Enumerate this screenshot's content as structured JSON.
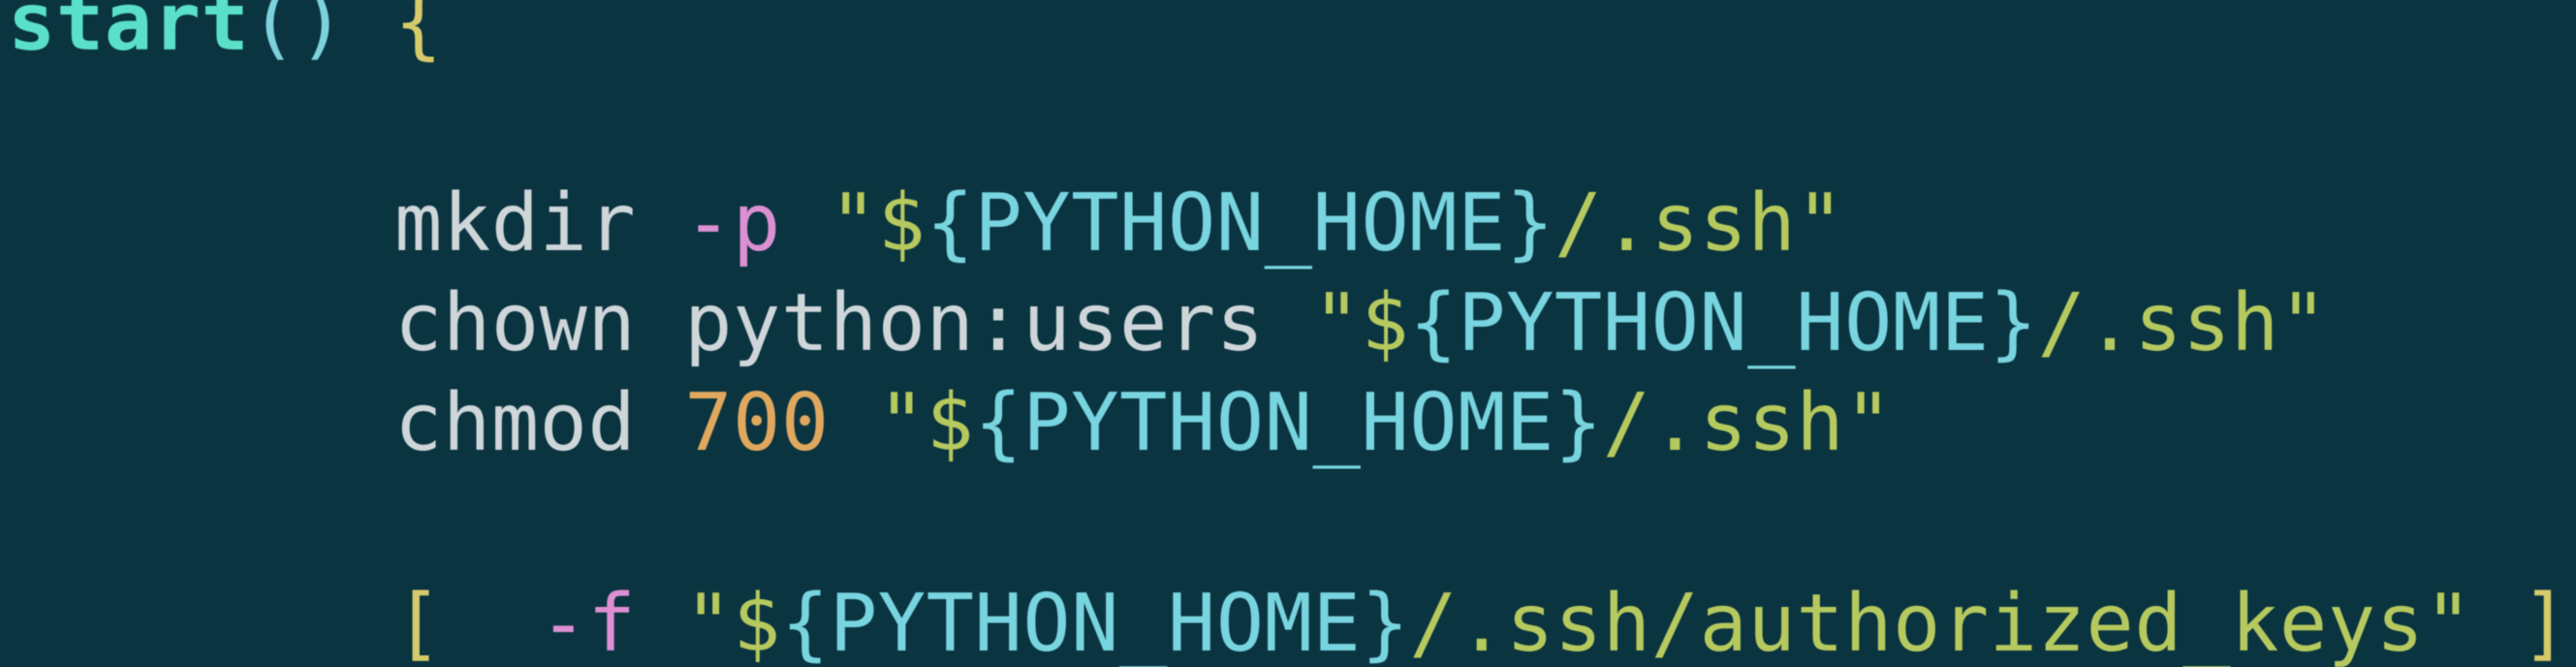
{
  "code": {
    "line1": {
      "func": "start",
      "paren_open": "(",
      "paren_close": ")",
      "brace_open": "{"
    },
    "line2_blank": "",
    "line3": {
      "indent": "        ",
      "cmd": "mkdir",
      "flag": "-p",
      "q1": "\"",
      "dollar": "$",
      "vbo": "{",
      "var": "PYTHON_HOME",
      "vbc": "}",
      "path": "/.ssh",
      "q2": "\""
    },
    "line4": {
      "indent": "        ",
      "cmd": "chown",
      "arg": "python:users",
      "q1": "\"",
      "dollar": "$",
      "vbo": "{",
      "var": "PYTHON_HOME",
      "vbc": "}",
      "path": "/.ssh",
      "q2": "\""
    },
    "line5": {
      "indent": "        ",
      "cmd": "chmod",
      "num": "700",
      "q1": "\"",
      "dollar": "$",
      "vbo": "{",
      "var": "PYTHON_HOME",
      "vbc": "}",
      "path": "/.ssh",
      "q2": "\""
    },
    "line6_blank": "",
    "line7": {
      "indent": "        ",
      "br_open": "[",
      "flag": "-f",
      "q1": "\"",
      "dollar": "$",
      "vbo": "{",
      "var": "PYTHON_HOME",
      "vbc": "}",
      "path": "/.ssh/authorized_keys",
      "q2": "\"",
      "br_close": "]"
    }
  }
}
